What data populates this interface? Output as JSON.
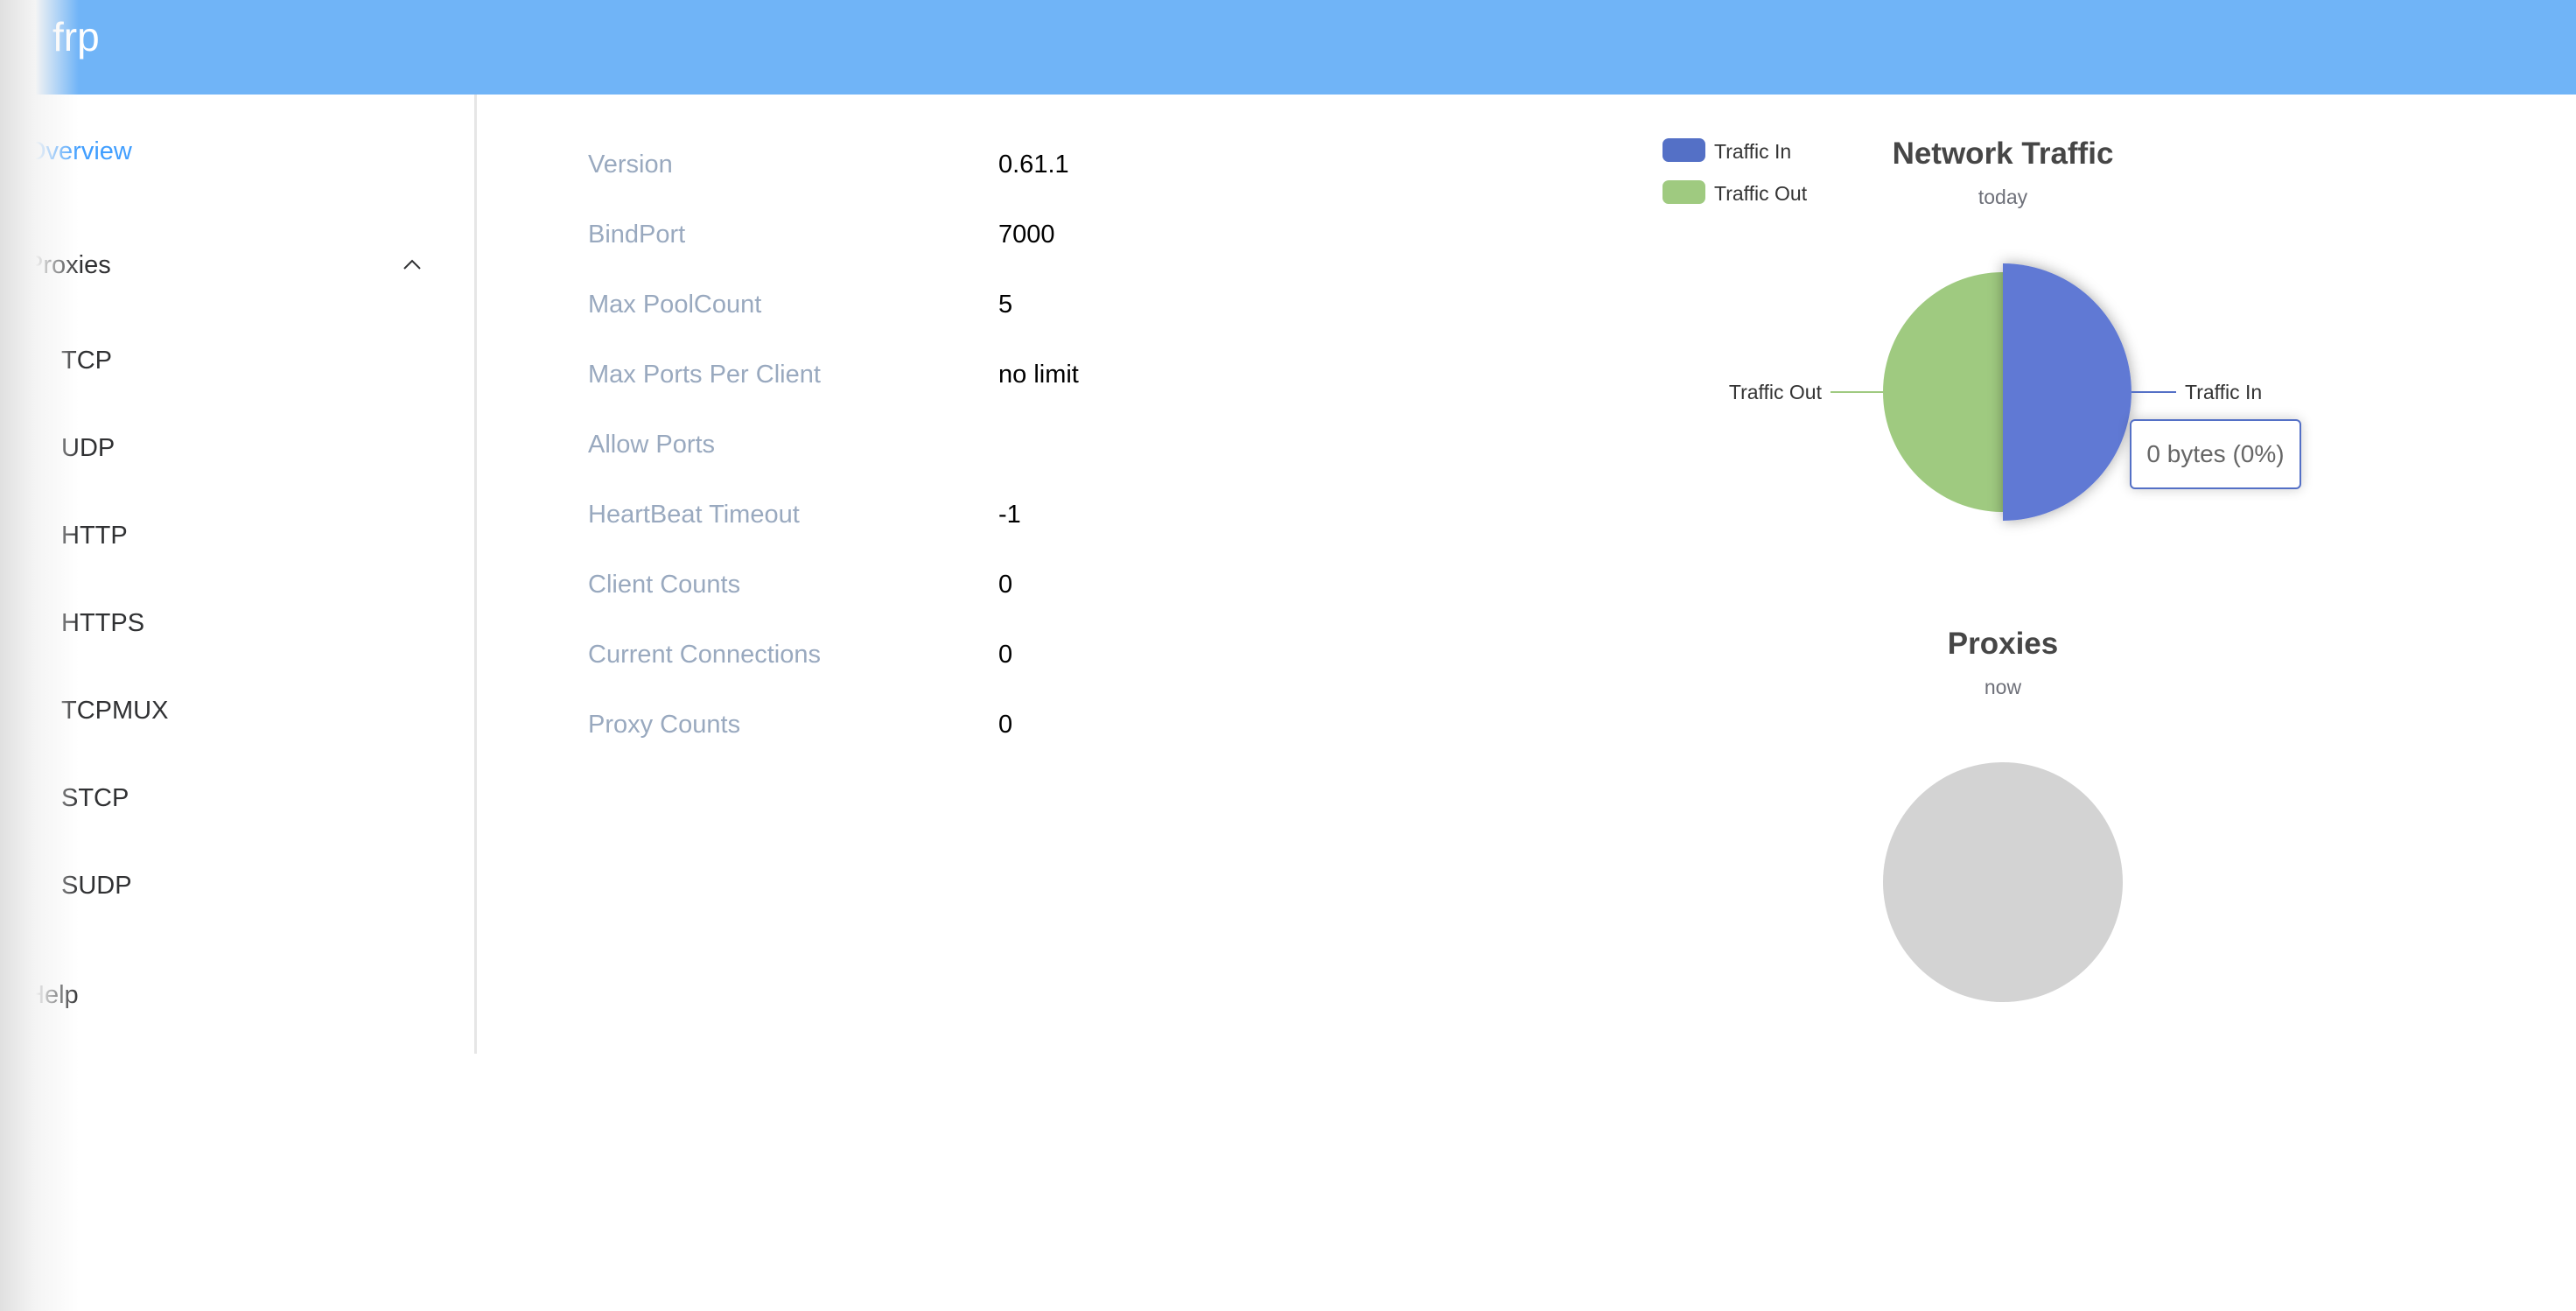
{
  "header": {
    "brand": "frp"
  },
  "sidebar": {
    "overview": "Overview",
    "proxies": {
      "label": "Proxies",
      "expanded": true,
      "toggle_icon": "chevron-up-icon",
      "items": [
        "TCP",
        "UDP",
        "HTTP",
        "HTTPS",
        "TCPMUX",
        "STCP",
        "SUDP"
      ]
    },
    "help": "Help"
  },
  "server_info": [
    {
      "label": "Version",
      "value": "0.61.1"
    },
    {
      "label": "BindPort",
      "value": "7000"
    },
    {
      "label": "Max PoolCount",
      "value": "5"
    },
    {
      "label": "Max Ports Per Client",
      "value": "no limit"
    },
    {
      "label": "Allow Ports",
      "value": ""
    },
    {
      "label": "HeartBeat Timeout",
      "value": "-1"
    },
    {
      "label": "Client Counts",
      "value": "0"
    },
    {
      "label": "Current Connections",
      "value": "0"
    },
    {
      "label": "Proxy Counts",
      "value": "0"
    }
  ],
  "colors": {
    "header": "#70b4f7",
    "active_nav": "#409eff",
    "traffic_in": "#6079d4",
    "traffic_out": "#9fca80",
    "empty_pie": "#d3d3d3"
  },
  "chart_data": [
    {
      "type": "pie",
      "title": "Network Traffic",
      "subtitle": "today",
      "legend": [
        "Traffic In",
        "Traffic Out"
      ],
      "legend_position": "top-left",
      "series": [
        {
          "name": "Traffic In",
          "value": 0,
          "display_share": 0.5,
          "color": "#6079d4",
          "emphasized": true
        },
        {
          "name": "Traffic Out",
          "value": 0,
          "display_share": 0.5,
          "color": "#9fca80"
        }
      ],
      "tooltip": {
        "target": "Traffic In",
        "text": "0 bytes (0%)"
      }
    },
    {
      "type": "pie",
      "title": "Proxies",
      "subtitle": "now",
      "series": [],
      "empty": true,
      "color": "#d3d3d3"
    }
  ]
}
